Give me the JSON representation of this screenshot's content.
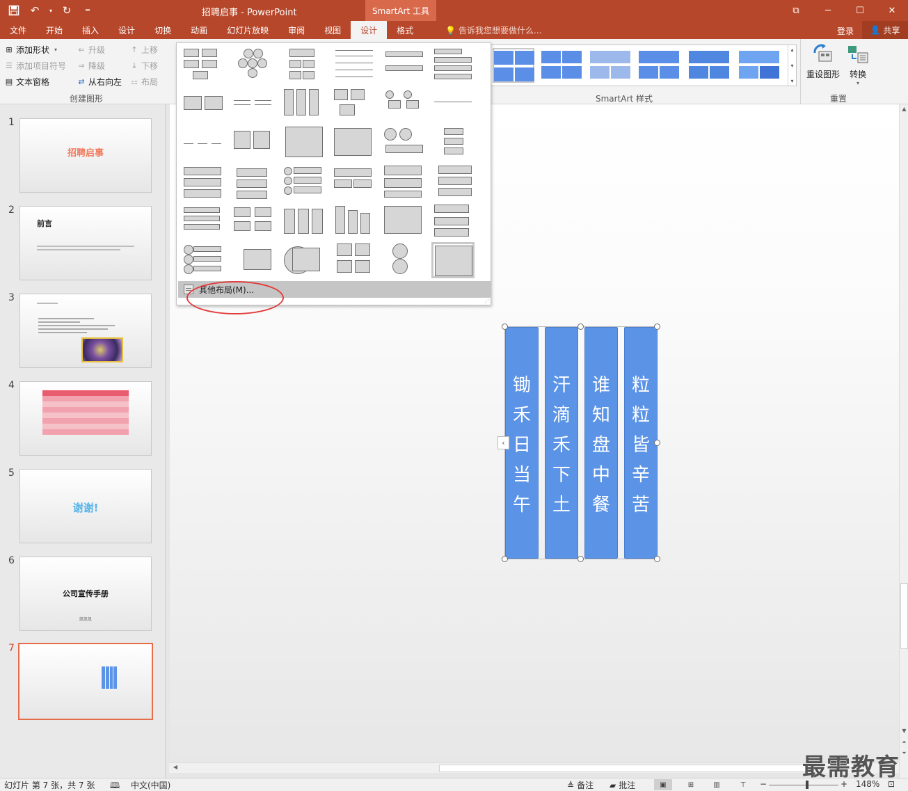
{
  "titlebar": {
    "doc_title": "招聘启事 - PowerPoint",
    "context_tab": "SmartArt 工具",
    "qat": {
      "save": "save-icon",
      "undo": "undo-icon",
      "redo": "redo-icon",
      "customize": "customize-qat-icon"
    }
  },
  "tabs": [
    "文件",
    "开始",
    "插入",
    "设计",
    "切换",
    "动画",
    "幻灯片放映",
    "审阅",
    "视图",
    "设计",
    "格式"
  ],
  "active_tab_index": 9,
  "tell_me": "告诉我您想要做什么...",
  "account": {
    "login": "登录",
    "share": "共享"
  },
  "ribbon": {
    "create_group": {
      "add_shape": "添加形状",
      "add_bullet": "添加项目符号",
      "text_pane": "文本窗格",
      "promote": "升级",
      "demote": "降级",
      "right_to_left": "从右向左",
      "move_up": "上移",
      "move_down": "下移",
      "layout": "布局",
      "label": "创建图形"
    },
    "styles_label": "SmartArt 样式",
    "reset_group": {
      "reset": "重设图形",
      "convert": "转换",
      "label": "重置"
    }
  },
  "layout_dropdown": {
    "more_layouts": "其他布局(M)..."
  },
  "slides": [
    {
      "num": "1",
      "title": "招聘启事"
    },
    {
      "num": "2",
      "title": "前言"
    },
    {
      "num": "3",
      "title": ""
    },
    {
      "num": "4",
      "title": ""
    },
    {
      "num": "5",
      "title": "谢谢!"
    },
    {
      "num": "6",
      "title": "公司宣传手册",
      "author": "凯凯凯"
    },
    {
      "num": "7",
      "title": ""
    }
  ],
  "smartart": {
    "columns": [
      {
        "chars": [
          "锄",
          "禾",
          "日",
          "当",
          "午"
        ]
      },
      {
        "chars": [
          "汗",
          "滴",
          "禾",
          "下",
          "土"
        ]
      },
      {
        "chars": [
          "谁",
          "知",
          "盘",
          "中",
          "餐"
        ]
      },
      {
        "chars": [
          "粒",
          "粒",
          "皆",
          "辛",
          "苦"
        ]
      }
    ],
    "fill_color": "#5b93e6"
  },
  "status": {
    "slide_info": "幻灯片 第 7 张，共 7 张",
    "language": "中文(中国)",
    "notes": "备注",
    "comments": "批注",
    "zoom": "148%"
  },
  "watermark": "最需教育"
}
